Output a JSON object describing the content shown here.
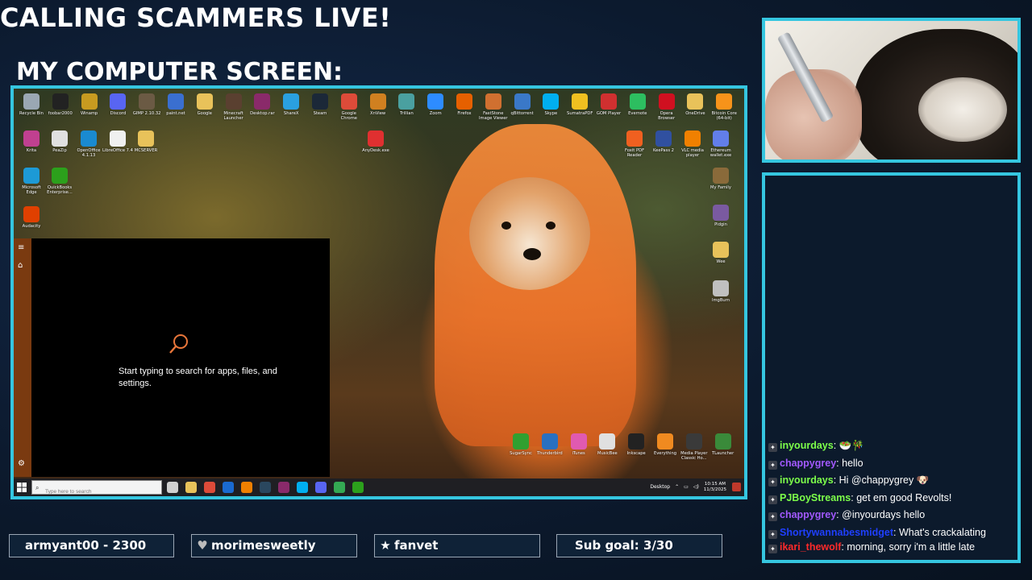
{
  "overlay": {
    "title": "CALLING SCAMMERS LIVE!",
    "subtitle": "MY COMPUTER SCREEN:",
    "accent_color": "#35c6e0"
  },
  "desktop": {
    "icons_row1": [
      {
        "label": "Recycle Bin",
        "icon": "recycle-bin-icon",
        "color": "#9aa7b3"
      },
      {
        "label": "foobar2000",
        "icon": "foobar-icon",
        "color": "#222"
      },
      {
        "label": "Winamp",
        "icon": "winamp-icon",
        "color": "#c89b20"
      },
      {
        "label": "Discord",
        "icon": "discord-icon",
        "color": "#5865f2"
      },
      {
        "label": "GIMP 2.10.32",
        "icon": "gimp-icon",
        "color": "#6b5a44"
      },
      {
        "label": "paint.net",
        "icon": "paintnet-icon",
        "color": "#3a6fd0"
      },
      {
        "label": "Google",
        "icon": "folder-icon",
        "color": "#e8c25a"
      },
      {
        "label": "Minecraft Launcher",
        "icon": "minecraft-icon",
        "color": "#5a4030"
      },
      {
        "label": "Desktop.rar",
        "icon": "winrar-icon",
        "color": "#8a2a6a"
      },
      {
        "label": "ShareX",
        "icon": "sharex-icon",
        "color": "#2aa0e0"
      },
      {
        "label": "Steam",
        "icon": "steam-icon",
        "color": "#1b2838"
      },
      {
        "label": "Google Chrome",
        "icon": "chrome-icon",
        "color": "#dd4b39"
      },
      {
        "label": "XnView",
        "icon": "xnview-icon",
        "color": "#d08020"
      },
      {
        "label": "Trillian",
        "icon": "trillian-icon",
        "color": "#4aa0a0"
      },
      {
        "label": "Zoom",
        "icon": "zoom-icon",
        "color": "#2d8cff"
      },
      {
        "label": "Firefox",
        "icon": "firefox-icon",
        "color": "#e66000"
      },
      {
        "label": "FastStone Image Viewer",
        "icon": "faststone-icon",
        "color": "#d07030"
      },
      {
        "label": "qBittorrent",
        "icon": "qbittorrent-icon",
        "color": "#3a78c8"
      },
      {
        "label": "Skype",
        "icon": "skype-icon",
        "color": "#00aff0"
      },
      {
        "label": "SumatraPDF",
        "icon": "sumatra-icon",
        "color": "#f0c020"
      },
      {
        "label": "GOM Player",
        "icon": "gom-icon",
        "color": "#d03030"
      },
      {
        "label": "Evernote",
        "icon": "evernote-icon",
        "color": "#2dbe60"
      },
      {
        "label": "Opera Browser",
        "icon": "opera-icon",
        "color": "#d01020"
      },
      {
        "label": "OneDrive",
        "icon": "onedrive-icon",
        "color": "#e8c25a"
      },
      {
        "label": "Bitcoin Core (64-bit)",
        "icon": "bitcoin-icon",
        "color": "#f7931a"
      }
    ],
    "icons_left": [
      {
        "label": "Krita",
        "icon": "krita-icon",
        "color": "#c04090"
      },
      {
        "label": "PeaZip",
        "icon": "peazip-icon",
        "color": "#e0e0e0"
      },
      {
        "label": "OpenOffice 4.1.13",
        "icon": "openoffice-icon",
        "color": "#1a8ad0"
      },
      {
        "label": "LibreOffice 7.4",
        "icon": "libreoffice-icon",
        "color": "#f0f0f0"
      },
      {
        "label": "MCSERVER",
        "icon": "folder-icon",
        "color": "#e8c25a"
      },
      {
        "label": "AnyDesk.exe",
        "icon": "anydesk-icon",
        "color": "#e03030"
      },
      {
        "label": "Microsoft Edge",
        "icon": "edge-icon",
        "color": "#1d9ad6"
      },
      {
        "label": "QuickBooks Enterprise...",
        "icon": "quickbooks-icon",
        "color": "#2ca01c"
      },
      {
        "label": "Audacity",
        "icon": "audacity-icon",
        "color": "#e04000"
      }
    ],
    "icons_right": [
      {
        "label": "Foxit PDF Reader",
        "icon": "foxit-icon",
        "color": "#f06020"
      },
      {
        "label": "KeePass 2",
        "icon": "keepass-icon",
        "color": "#3050a0"
      },
      {
        "label": "VLC media player",
        "icon": "vlc-icon",
        "color": "#f08000"
      },
      {
        "label": "Ethereum wallet.exe",
        "icon": "ethereum-icon",
        "color": "#627eea"
      },
      {
        "label": "My Family",
        "icon": "folder-icon",
        "color": "#8a6a3a"
      },
      {
        "label": "Pidgin",
        "icon": "pidgin-icon",
        "color": "#7a5aa0"
      },
      {
        "label": "Wee",
        "icon": "folder-icon",
        "color": "#e8c25a"
      },
      {
        "label": "ImgBurn",
        "icon": "imgburn-icon",
        "color": "#c0c0c0"
      }
    ],
    "icons_bottom": [
      {
        "label": "SugarSync",
        "icon": "sugarsync-icon",
        "color": "#30a030"
      },
      {
        "label": "Thunderbird",
        "icon": "thunderbird-icon",
        "color": "#2a70c0"
      },
      {
        "label": "iTunes",
        "icon": "itunes-icon",
        "color": "#e05ab0"
      },
      {
        "label": "MusicBee",
        "icon": "musicbee-icon",
        "color": "#e0e0e0"
      },
      {
        "label": "Inkscape",
        "icon": "inkscape-icon",
        "color": "#222"
      },
      {
        "label": "Everything",
        "icon": "everything-icon",
        "color": "#f08a20"
      },
      {
        "label": "Media Player Classic Ho...",
        "icon": "mpc-icon",
        "color": "#3a3a3a"
      },
      {
        "label": "TLauncher",
        "icon": "tlauncher-icon",
        "color": "#3a8a3a"
      }
    ],
    "start_menu": {
      "prompt": "Start typing to search for apps, files, and settings."
    },
    "taskbar": {
      "search_placeholder": "Type here to search",
      "desktop_label": "Desktop",
      "time": "10:15 AM",
      "date": "11/3/2025",
      "apps": [
        {
          "icon": "task-view-icon",
          "color": "#d0d0d0"
        },
        {
          "icon": "file-explorer-icon",
          "color": "#e8c25a"
        },
        {
          "icon": "chrome-icon",
          "color": "#dd4b39"
        },
        {
          "icon": "outlook-icon",
          "color": "#1a6ad0"
        },
        {
          "icon": "vlc-icon",
          "color": "#f08000"
        },
        {
          "icon": "steam-icon",
          "color": "#2a475e"
        },
        {
          "icon": "winrar-icon",
          "color": "#8a2a6a"
        },
        {
          "icon": "skype-icon",
          "color": "#00aff0"
        },
        {
          "icon": "discord-icon",
          "color": "#5865f2"
        },
        {
          "icon": "chrome-alt-icon",
          "color": "#34a853"
        },
        {
          "icon": "quickbooks-icon",
          "color": "#2ca01c"
        }
      ]
    }
  },
  "chat": {
    "messages": [
      {
        "user": "inyourdays",
        "user_color": "#7dff4a",
        "text": "🥗🎋"
      },
      {
        "user": "chappygrey",
        "user_color": "#a259ff",
        "text": "hello"
      },
      {
        "user": "inyourdays",
        "user_color": "#7dff4a",
        "text": "Hi @chappygrey 🐶"
      },
      {
        "user": "PJBoyStreams",
        "user_color": "#7dff4a",
        "text": "get em good Revolts!"
      },
      {
        "user": "chappygrey",
        "user_color": "#a259ff",
        "text": "@inyourdays hello"
      },
      {
        "user": "Shortywannabesmidget",
        "user_color": "#1f3fff",
        "text": "What's crackalating"
      },
      {
        "user": "ikari_thewolf",
        "user_color": "#ff2a2a",
        "text": "morning, sorry i'm a little late"
      }
    ]
  },
  "bottom_bar": {
    "box1": "armyant00 - 2300",
    "box2": "morimesweetly",
    "box3": "fanvet",
    "box4": "Sub goal: 3/30",
    "box2_icon": "heart-icon",
    "box3_icon": "star-icon"
  }
}
